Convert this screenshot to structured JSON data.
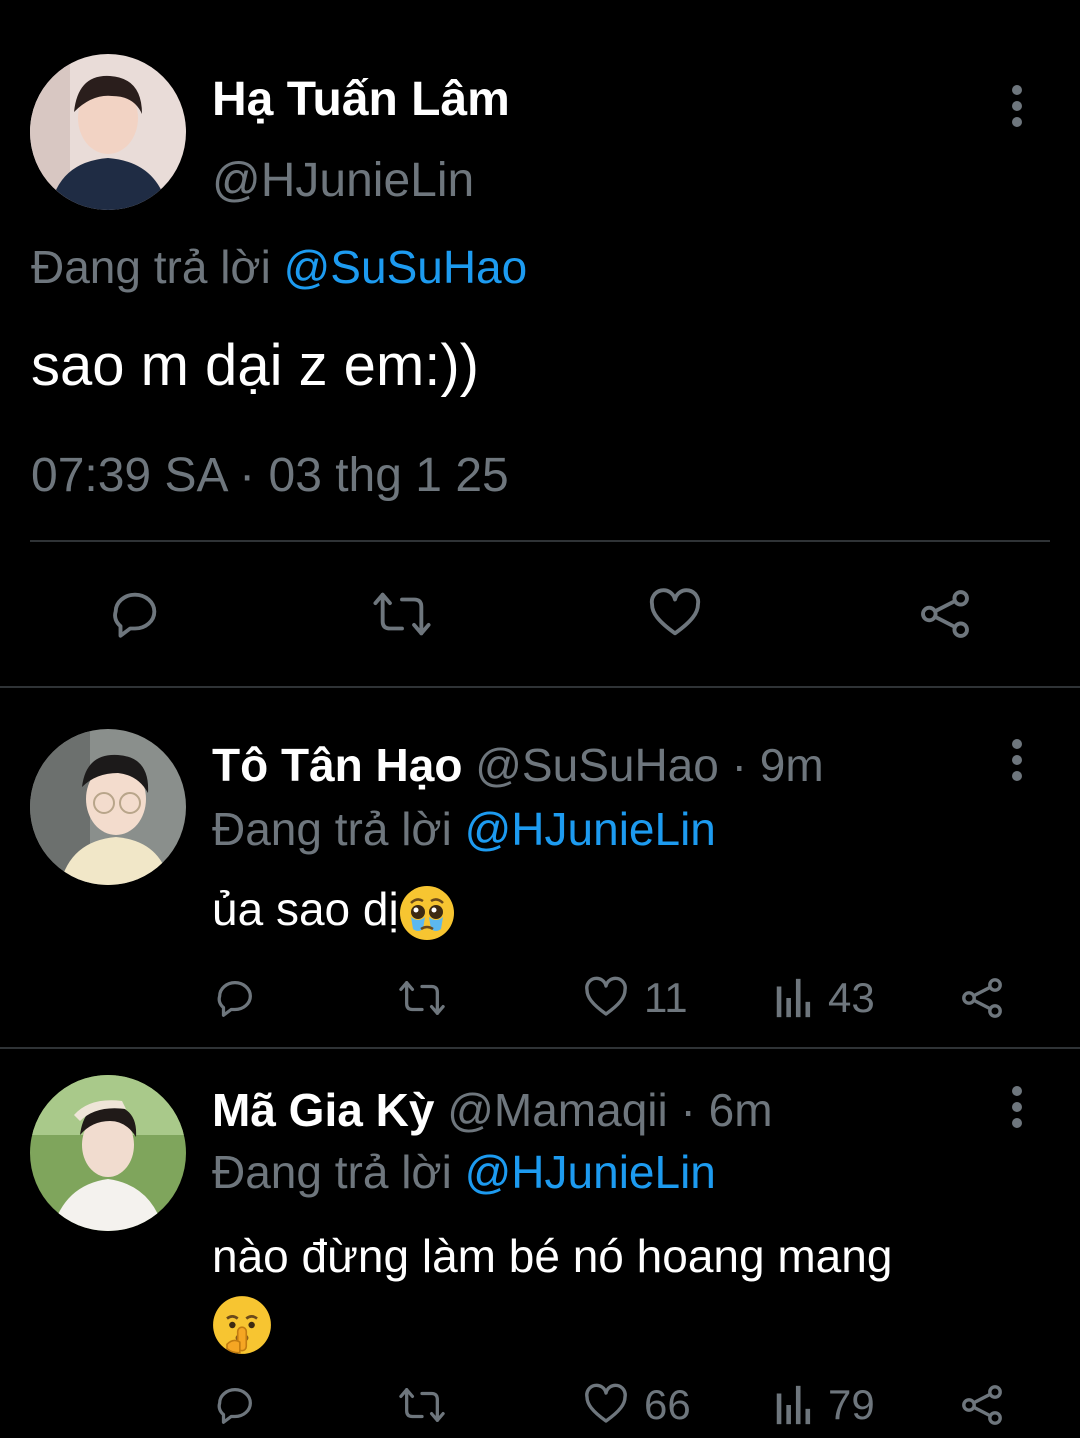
{
  "main_tweet": {
    "author_name": "Hạ Tuấn Lâm",
    "author_handle": "@HJunieLin",
    "reply_prefix": "Đang trả lời ",
    "reply_to": "@SuSuHao",
    "text": "sao m dại z em:))",
    "timestamp": "07:39 SA · 03 thg 1 25",
    "actions": [
      "reply-icon",
      "retweet-icon",
      "like-icon",
      "share-icon"
    ]
  },
  "replies": [
    {
      "author_name": "Tô Tân Hạo",
      "author_handle": "@SuSuHao",
      "time_ago": " · 9m",
      "reply_prefix": "Đang trả lời ",
      "reply_to": "@HJunieLin",
      "text": "ủa sao dị",
      "emoji": "pleading-face-crying",
      "likes": "11",
      "views": "43"
    },
    {
      "author_name": "Mã Gia Kỳ",
      "author_handle": "@Mamaqii",
      "time_ago": " · 6m",
      "reply_prefix": "Đang trả lời ",
      "reply_to": "@HJunieLin",
      "text": "nào đừng làm bé nó hoang mang",
      "emoji": "shushing-face",
      "likes": "66",
      "views": "79"
    }
  ],
  "colors": {
    "background": "#000000",
    "text": "#ffffff",
    "muted": "#6e767d",
    "accent": "#1d9bf0",
    "divider": "#2f3336"
  }
}
